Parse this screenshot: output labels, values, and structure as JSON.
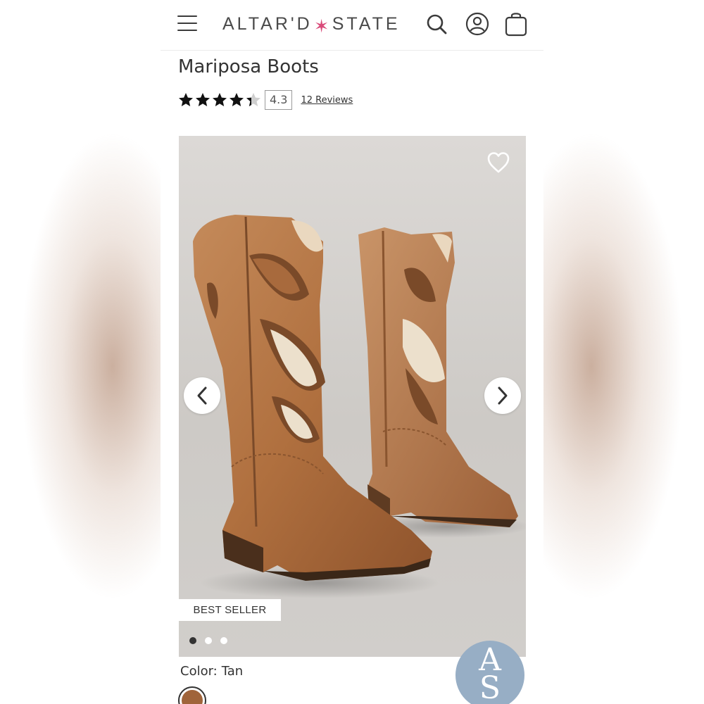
{
  "brand": {
    "logo_left": "ALTAR'D",
    "logo_right": "STATE",
    "star_color": "#d94b7a"
  },
  "product": {
    "title": "Mariposa Boots",
    "rating": 4.3,
    "rating_text": "4.3",
    "reviews_label": "12 Reviews",
    "badge": "BEST SELLER",
    "color_label": "Color:",
    "color_value": "Tan",
    "swatch_color": "#a0643a"
  },
  "gallery": {
    "slide_count": 3,
    "active_slide": 0
  },
  "icons": {
    "menu": "hamburger-menu-icon",
    "search": "search-icon",
    "account": "account-icon",
    "cart": "shopping-bag-icon",
    "wishlist": "heart-icon",
    "prev": "chevron-left-icon",
    "next": "chevron-right-icon"
  },
  "watermark": {
    "text_line1": "A",
    "text_line2": "S"
  }
}
